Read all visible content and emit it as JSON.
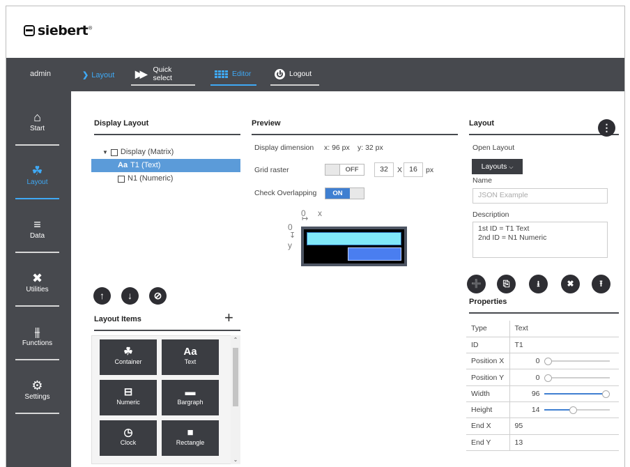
{
  "brand": {
    "name": "siebert",
    "mark": "®"
  },
  "topbar": {
    "user": "admin",
    "breadcrumb": "Layout",
    "quick_select": "Quick select",
    "editor": "Editor",
    "logout": "Logout"
  },
  "sidebar": {
    "items": [
      {
        "label": "Start",
        "icon": "home-icon"
      },
      {
        "label": "Layout",
        "icon": "layout-icon"
      },
      {
        "label": "Data",
        "icon": "database-icon"
      },
      {
        "label": "Utilities",
        "icon": "tools-icon"
      },
      {
        "label": "Functions",
        "icon": "sliders-icon"
      },
      {
        "label": "Settings",
        "icon": "gears-icon"
      }
    ]
  },
  "display_layout": {
    "title": "Display Layout",
    "tree": {
      "root": "Display (Matrix)",
      "children": [
        {
          "icon": "Aa",
          "label": "T1 (Text)",
          "selected": true
        },
        {
          "icon": "numeric-icon",
          "label": "N1 (Numeric)",
          "selected": false
        }
      ]
    }
  },
  "layout_items": {
    "title": "Layout Items",
    "add": "+",
    "tiles": [
      {
        "label": "Container",
        "icon": "container-icon"
      },
      {
        "label": "Text",
        "icon": "Aa"
      },
      {
        "label": "Numeric",
        "icon": "numeric-icon"
      },
      {
        "label": "Bargraph",
        "icon": "bargraph-icon"
      },
      {
        "label": "Clock",
        "icon": "clock-icon"
      },
      {
        "label": "Rectangle",
        "icon": "rectangle-icon"
      }
    ]
  },
  "preview": {
    "title": "Preview",
    "dimension_label": "Display dimension",
    "dim_x": "x: 96 px",
    "dim_y": "y: 32 px",
    "grid_label": "Grid raster",
    "grid_state": "OFF",
    "grid_x": "32",
    "grid_sep": "X",
    "grid_y": "16",
    "grid_unit": "px",
    "overlap_label": "Check Overlapping",
    "overlap_state": "ON",
    "axis_origin_x": "0",
    "axis_x": "x",
    "axis_origin_y": "0",
    "axis_y": "y"
  },
  "layout_panel": {
    "title": "Layout",
    "open_label": "Open Layout",
    "layouts_button": "Layouts",
    "name_label": "Name",
    "name_placeholder": "JSON Example",
    "desc_label": "Description",
    "desc_line1": "1st ID = T1 Text",
    "desc_line2": "2nd ID = N1 Numeric"
  },
  "properties": {
    "title": "Properties",
    "rows": [
      {
        "key": "Type",
        "value": "Text"
      },
      {
        "key": "ID",
        "value": "T1"
      },
      {
        "key": "Position X",
        "value": "0",
        "slider": 0.0
      },
      {
        "key": "Position Y",
        "value": "0",
        "slider": 0.0
      },
      {
        "key": "Width",
        "value": "96",
        "slider": 1.0
      },
      {
        "key": "Height",
        "value": "14",
        "slider": 0.44
      },
      {
        "key": "End X",
        "value": "95"
      },
      {
        "key": "End Y",
        "value": "13"
      }
    ]
  },
  "colors": {
    "accent": "#3fa9f5",
    "dark_bar": "#47494e",
    "selected": "#5b9bd9",
    "toggle_on": "#3f7fd1",
    "preview_text": "#80e8f8",
    "preview_numeric": "#4a7ef0"
  }
}
